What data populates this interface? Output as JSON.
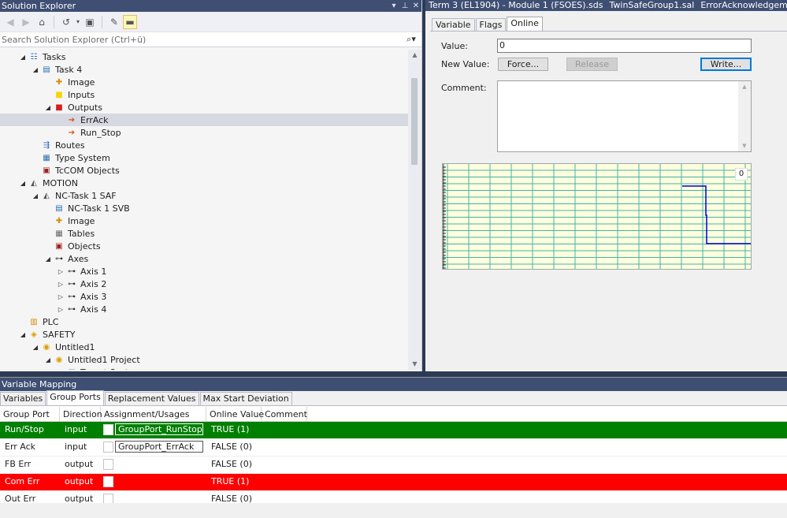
{
  "solution_explorer": {
    "title": "Solution Explorer",
    "search_placeholder": "Search Solution Explorer (Ctrl+ü)",
    "tree": [
      {
        "label": "Tasks",
        "indent": 1,
        "exp": "open",
        "icon": "tasks-icon"
      },
      {
        "label": "Task 4",
        "indent": 2,
        "exp": "open",
        "icon": "task-icon"
      },
      {
        "label": "Image",
        "indent": 3,
        "exp": "",
        "icon": "image-icon"
      },
      {
        "label": "Inputs",
        "indent": 3,
        "exp": "",
        "icon": "inputs-icon"
      },
      {
        "label": "Outputs",
        "indent": 3,
        "exp": "open",
        "icon": "outputs-icon"
      },
      {
        "label": "ErrAck",
        "indent": 4,
        "exp": "",
        "icon": "output-var-icon",
        "selected": true
      },
      {
        "label": "Run_Stop",
        "indent": 4,
        "exp": "",
        "icon": "output-var-icon"
      },
      {
        "label": "Routes",
        "indent": 2,
        "exp": "",
        "icon": "routes-icon"
      },
      {
        "label": "Type System",
        "indent": 2,
        "exp": "",
        "icon": "type-system-icon"
      },
      {
        "label": "TcCOM Objects",
        "indent": 2,
        "exp": "",
        "icon": "tccom-icon"
      },
      {
        "label": "MOTION",
        "indent": 1,
        "exp": "open",
        "icon": "motion-icon"
      },
      {
        "label": "NC-Task 1 SAF",
        "indent": 2,
        "exp": "open",
        "icon": "nc-task-icon"
      },
      {
        "label": "NC-Task 1 SVB",
        "indent": 3,
        "exp": "",
        "icon": "task-icon"
      },
      {
        "label": "Image",
        "indent": 3,
        "exp": "",
        "icon": "image-icon"
      },
      {
        "label": "Tables",
        "indent": 3,
        "exp": "",
        "icon": "tables-icon"
      },
      {
        "label": "Objects",
        "indent": 3,
        "exp": "",
        "icon": "objects-icon"
      },
      {
        "label": "Axes",
        "indent": 3,
        "exp": "open",
        "icon": "axes-icon"
      },
      {
        "label": "Axis 1",
        "indent": 4,
        "exp": "closed",
        "icon": "axis-icon"
      },
      {
        "label": "Axis 2",
        "indent": 4,
        "exp": "closed",
        "icon": "axis-icon"
      },
      {
        "label": "Axis 3",
        "indent": 4,
        "exp": "closed",
        "icon": "axis-icon"
      },
      {
        "label": "Axis 4",
        "indent": 4,
        "exp": "closed",
        "icon": "axis-icon"
      },
      {
        "label": "PLC",
        "indent": 1,
        "exp": "",
        "icon": "plc-icon"
      },
      {
        "label": "SAFETY",
        "indent": 1,
        "exp": "open",
        "icon": "safety-icon"
      },
      {
        "label": "Untitled1",
        "indent": 2,
        "exp": "open",
        "icon": "safety-project-icon"
      },
      {
        "label": "Untitled1 Project",
        "indent": 3,
        "exp": "open",
        "icon": "safety-project-icon"
      },
      {
        "label": "Target System",
        "indent": 4,
        "exp": "",
        "icon": "target-icon"
      }
    ]
  },
  "editor": {
    "doc_tabs": [
      "Term 3 (EL1904) - Module 1 (FSOES).sds",
      "TwinSafeGroup1.sal",
      "ErrorAcknowledgeme"
    ],
    "sub_tabs": [
      "Variable",
      "Flags",
      "Online"
    ],
    "active_sub_tab": "Online",
    "value_label": "Value:",
    "value": "0",
    "new_value_label": "New Value:",
    "force_label": "Force...",
    "release_label": "Release",
    "write_label": "Write...",
    "comment_label": "Comment:",
    "comment_value": "",
    "scope_value_label": "0"
  },
  "variable_mapping": {
    "title": "Variable Mapping",
    "tabs": [
      "Variables",
      "Group Ports",
      "Replacement Values",
      "Max Start Deviation"
    ],
    "active_tab": "Group Ports",
    "columns": [
      "Group Port",
      "Direction",
      "Assignment/Usages",
      "Online Value",
      "Comment"
    ],
    "rows": [
      {
        "port": "Run/Stop",
        "direction": "input",
        "assignment": "GroupPort_RunStop",
        "online": "TRUE (1)",
        "comment": "",
        "status": "green"
      },
      {
        "port": "Err Ack",
        "direction": "input",
        "assignment": "GroupPort_ErrAck",
        "online": "FALSE (0)",
        "comment": "",
        "status": "none"
      },
      {
        "port": "FB Err",
        "direction": "output",
        "assignment": "",
        "online": "FALSE (0)",
        "comment": "",
        "status": "none"
      },
      {
        "port": "Com Err",
        "direction": "output",
        "assignment": "",
        "online": "TRUE (1)",
        "comment": "",
        "status": "red"
      },
      {
        "port": "Out Err",
        "direction": "output",
        "assignment": "",
        "online": "FALSE (0)",
        "comment": "",
        "status": "none"
      }
    ]
  }
}
